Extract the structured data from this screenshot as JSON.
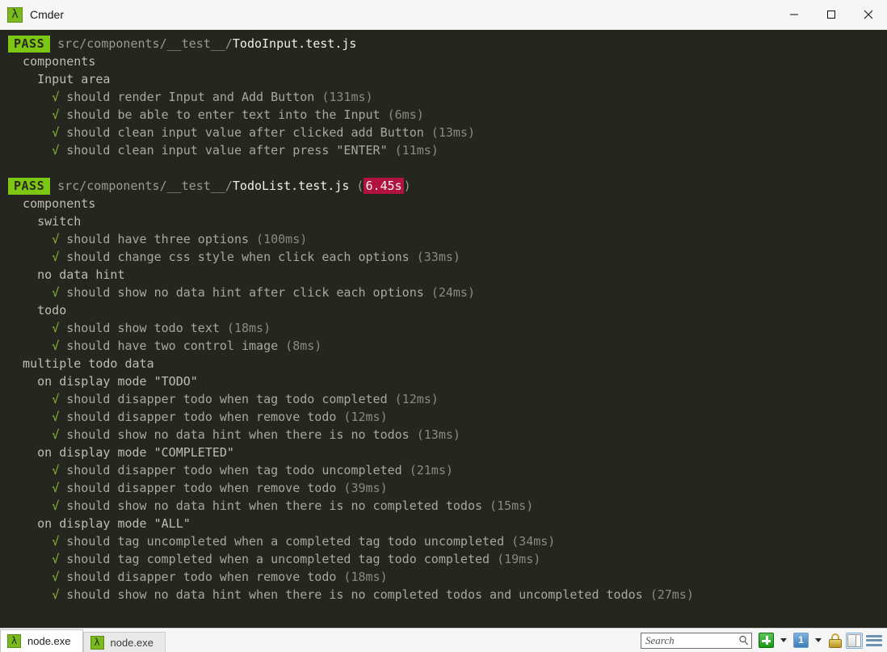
{
  "window": {
    "title": "Cmder",
    "app_icon": "lambda-icon",
    "icon_glyph": "λ",
    "minimize_label": "Minimize",
    "maximize_label": "Maximize",
    "close_label": "Close"
  },
  "terminal": {
    "background": "#262620",
    "pass_badge": "PASS",
    "pass_badge_bg": "#7ec614",
    "slow_badge_bg": "#b2123f",
    "check_glyph": "√",
    "blocks": [
      {
        "badge": "PASS",
        "path_dir": "src/components/__test__/",
        "path_file": "TodoInput.test.js",
        "duration": "",
        "lines": [
          {
            "indent": 2,
            "type": "suite",
            "text": "components"
          },
          {
            "indent": 4,
            "type": "suite",
            "text": "Input area"
          },
          {
            "indent": 6,
            "type": "test",
            "text": "should render Input and Add Button",
            "timing": "(131ms)"
          },
          {
            "indent": 6,
            "type": "test",
            "text": "should be able to enter text into the Input",
            "timing": "(6ms)"
          },
          {
            "indent": 6,
            "type": "test",
            "text": "should clean input value after clicked add Button",
            "timing": "(13ms)"
          },
          {
            "indent": 6,
            "type": "test",
            "text": "should clean input value after press \"ENTER\"",
            "timing": "(11ms)"
          }
        ]
      },
      {
        "badge": "PASS",
        "path_dir": "src/components/__test__/",
        "path_file": "TodoList.test.js",
        "duration": "6.45s",
        "lines": [
          {
            "indent": 2,
            "type": "suite",
            "text": "components"
          },
          {
            "indent": 4,
            "type": "suite",
            "text": "switch"
          },
          {
            "indent": 6,
            "type": "test",
            "text": "should have three options",
            "timing": "(100ms)"
          },
          {
            "indent": 6,
            "type": "test",
            "text": "should change css style when click each options",
            "timing": "(33ms)"
          },
          {
            "indent": 4,
            "type": "suite",
            "text": "no data hint"
          },
          {
            "indent": 6,
            "type": "test",
            "text": "should show no data hint after click each options",
            "timing": "(24ms)"
          },
          {
            "indent": 4,
            "type": "suite",
            "text": "todo"
          },
          {
            "indent": 6,
            "type": "test",
            "text": "should show todo text",
            "timing": "(18ms)"
          },
          {
            "indent": 6,
            "type": "test",
            "text": "should have two control image",
            "timing": "(8ms)"
          },
          {
            "indent": 2,
            "type": "suite",
            "text": "multiple todo data"
          },
          {
            "indent": 4,
            "type": "suite",
            "text": "on display mode \"TODO\""
          },
          {
            "indent": 6,
            "type": "test",
            "text": "should disapper todo when tag todo completed",
            "timing": "(12ms)"
          },
          {
            "indent": 6,
            "type": "test",
            "text": "should disapper todo when remove todo",
            "timing": "(12ms)"
          },
          {
            "indent": 6,
            "type": "test",
            "text": "should show no data hint when there is no todos",
            "timing": "(13ms)"
          },
          {
            "indent": 4,
            "type": "suite",
            "text": "on display mode \"COMPLETED\""
          },
          {
            "indent": 6,
            "type": "test",
            "text": "should disapper todo when tag todo uncompleted",
            "timing": "(21ms)"
          },
          {
            "indent": 6,
            "type": "test",
            "text": "should disapper todo when remove todo",
            "timing": "(39ms)"
          },
          {
            "indent": 6,
            "type": "test",
            "text": "should show no data hint when there is no completed todos",
            "timing": "(15ms)"
          },
          {
            "indent": 4,
            "type": "suite",
            "text": "on display mode \"ALL\""
          },
          {
            "indent": 6,
            "type": "test",
            "text": "should tag uncompleted when a completed tag todo uncompleted",
            "timing": "(34ms)"
          },
          {
            "indent": 6,
            "type": "test",
            "text": "should tag completed when a uncompleted tag todo completed",
            "timing": "(19ms)"
          },
          {
            "indent": 6,
            "type": "test",
            "text": "should disapper todo when remove todo",
            "timing": "(18ms)"
          },
          {
            "indent": 6,
            "type": "test",
            "text": "should show no data hint when there is no completed todos and uncompleted todos",
            "timing": "(27ms)"
          }
        ]
      }
    ]
  },
  "statusbar": {
    "tabs": [
      {
        "label": "node.exe",
        "icon": "lambda-icon",
        "active": true
      },
      {
        "label": "node.exe",
        "icon": "lambda-icon",
        "active": false
      }
    ],
    "tab_icon_glyph": "λ",
    "search": {
      "placeholder": "Search",
      "value": ""
    },
    "buttons": [
      {
        "name": "new-console-button",
        "icon": "plus-icon"
      },
      {
        "name": "new-console-dropdown",
        "icon": "chevron-down-icon"
      },
      {
        "name": "active-console-button",
        "icon": "one-icon",
        "label": "1"
      },
      {
        "name": "active-console-dropdown",
        "icon": "chevron-down-icon"
      },
      {
        "name": "lock-button",
        "icon": "lock-icon"
      },
      {
        "name": "split-view-button",
        "icon": "split-view-icon"
      },
      {
        "name": "menu-button",
        "icon": "hamburger-icon"
      }
    ]
  }
}
